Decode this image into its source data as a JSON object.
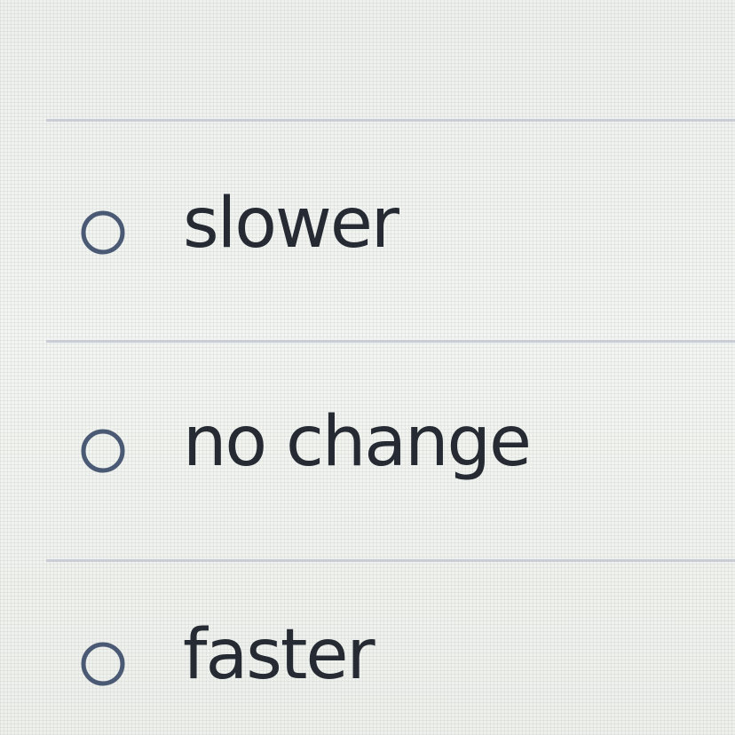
{
  "question": {
    "options": [
      {
        "label": "slower",
        "selected": false
      },
      {
        "label": "no change",
        "selected": false
      },
      {
        "label": "faster",
        "selected": false
      }
    ]
  },
  "colors": {
    "text": "#252a33",
    "radio_ring": "#4a5a74",
    "divider": "#c9ced6",
    "background": "#f2f4f1"
  },
  "icons": {
    "radio": "radio-button-unchecked-icon"
  }
}
